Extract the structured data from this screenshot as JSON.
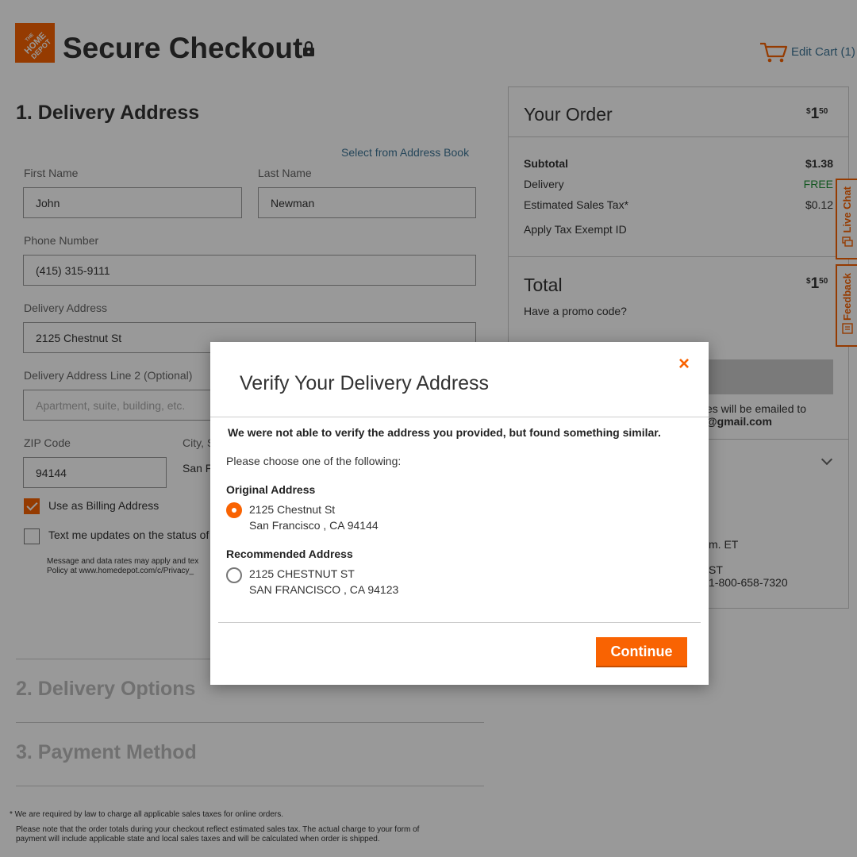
{
  "header": {
    "logo_text": "THE HOME DEPOT",
    "title": "Secure Checkout",
    "edit_cart": "Edit Cart (1)"
  },
  "delivery": {
    "section_title": "1. Delivery Address",
    "address_book_link": "Select from Address Book",
    "first_name_label": "First Name",
    "first_name_value": "John",
    "last_name_label": "Last Name",
    "last_name_value": "Newman",
    "phone_label": "Phone Number",
    "phone_value": "(415) 315-9111",
    "address_label": "Delivery Address",
    "address_value": "2125 Chestnut St",
    "address2_label": "Delivery Address Line 2 (Optional)",
    "address2_placeholder": "Apartment, suite, building, etc.",
    "zip_label": "ZIP Code",
    "zip_value": "94144",
    "city_label": "City, S",
    "city_value": "San F",
    "billing_checkbox_label": "Use as Billing Address",
    "billing_checked": true,
    "sms_checkbox_label": "Text me updates on the status of",
    "sms_checked": false,
    "sms_fine_print_1": "Message and data rates may apply and tex",
    "sms_fine_print_2": "Policy at www.homedepot.com/c/Privacy_"
  },
  "sections": {
    "delivery_options": "2. Delivery Options",
    "payment_method": "3. Payment Method"
  },
  "footer": {
    "tax_note": "* We are required by law to charge all applicable sales taxes for online orders.",
    "totals_note_1": "Please note that the order totals during your checkout reflect estimated sales tax. The actual charge to your form of",
    "totals_note_2": "payment will include applicable state and local sales taxes and will be calculated when order is shipped."
  },
  "order": {
    "heading": "Your Order",
    "total_dollars": "1",
    "total_cents": "50",
    "subtotal_label": "Subtotal",
    "subtotal_value": "$1.38",
    "delivery_label": "Delivery",
    "delivery_value": "FREE",
    "tax_label": "Estimated Sales Tax*",
    "tax_value": "$0.12",
    "tax_exempt_link": "Apply Tax Exempt ID",
    "total_label": "Total",
    "promo_link": "Have a promo code?",
    "email_note_1": "es will be emailed to",
    "email_note_2": "@gmail.com",
    "hours_fragment": "m. ET",
    "tz_fragment": "ST",
    "phone_fragment": "1-800-658-7320"
  },
  "side_tabs": {
    "live_chat": "Live Chat",
    "feedback": "Feedback"
  },
  "modal": {
    "title": "Verify Your Delivery Address",
    "close_label": "×",
    "message": "We were not able to verify the address you provided, but found something similar.",
    "instruction": "Please choose one of the following:",
    "original_heading": "Original Address",
    "original_line1": "2125 Chestnut St",
    "original_line2": "San Francisco , CA 94144",
    "original_selected": true,
    "recommended_heading": "Recommended Address",
    "recommended_line1": "2125 CHESTNUT ST",
    "recommended_line2": "SAN FRANCISCO , CA 94123",
    "recommended_selected": false,
    "continue_label": "Continue"
  },
  "colors": {
    "brand_orange": "#f96302",
    "link_blue": "#3e7697",
    "free_green": "#1f8f36"
  }
}
